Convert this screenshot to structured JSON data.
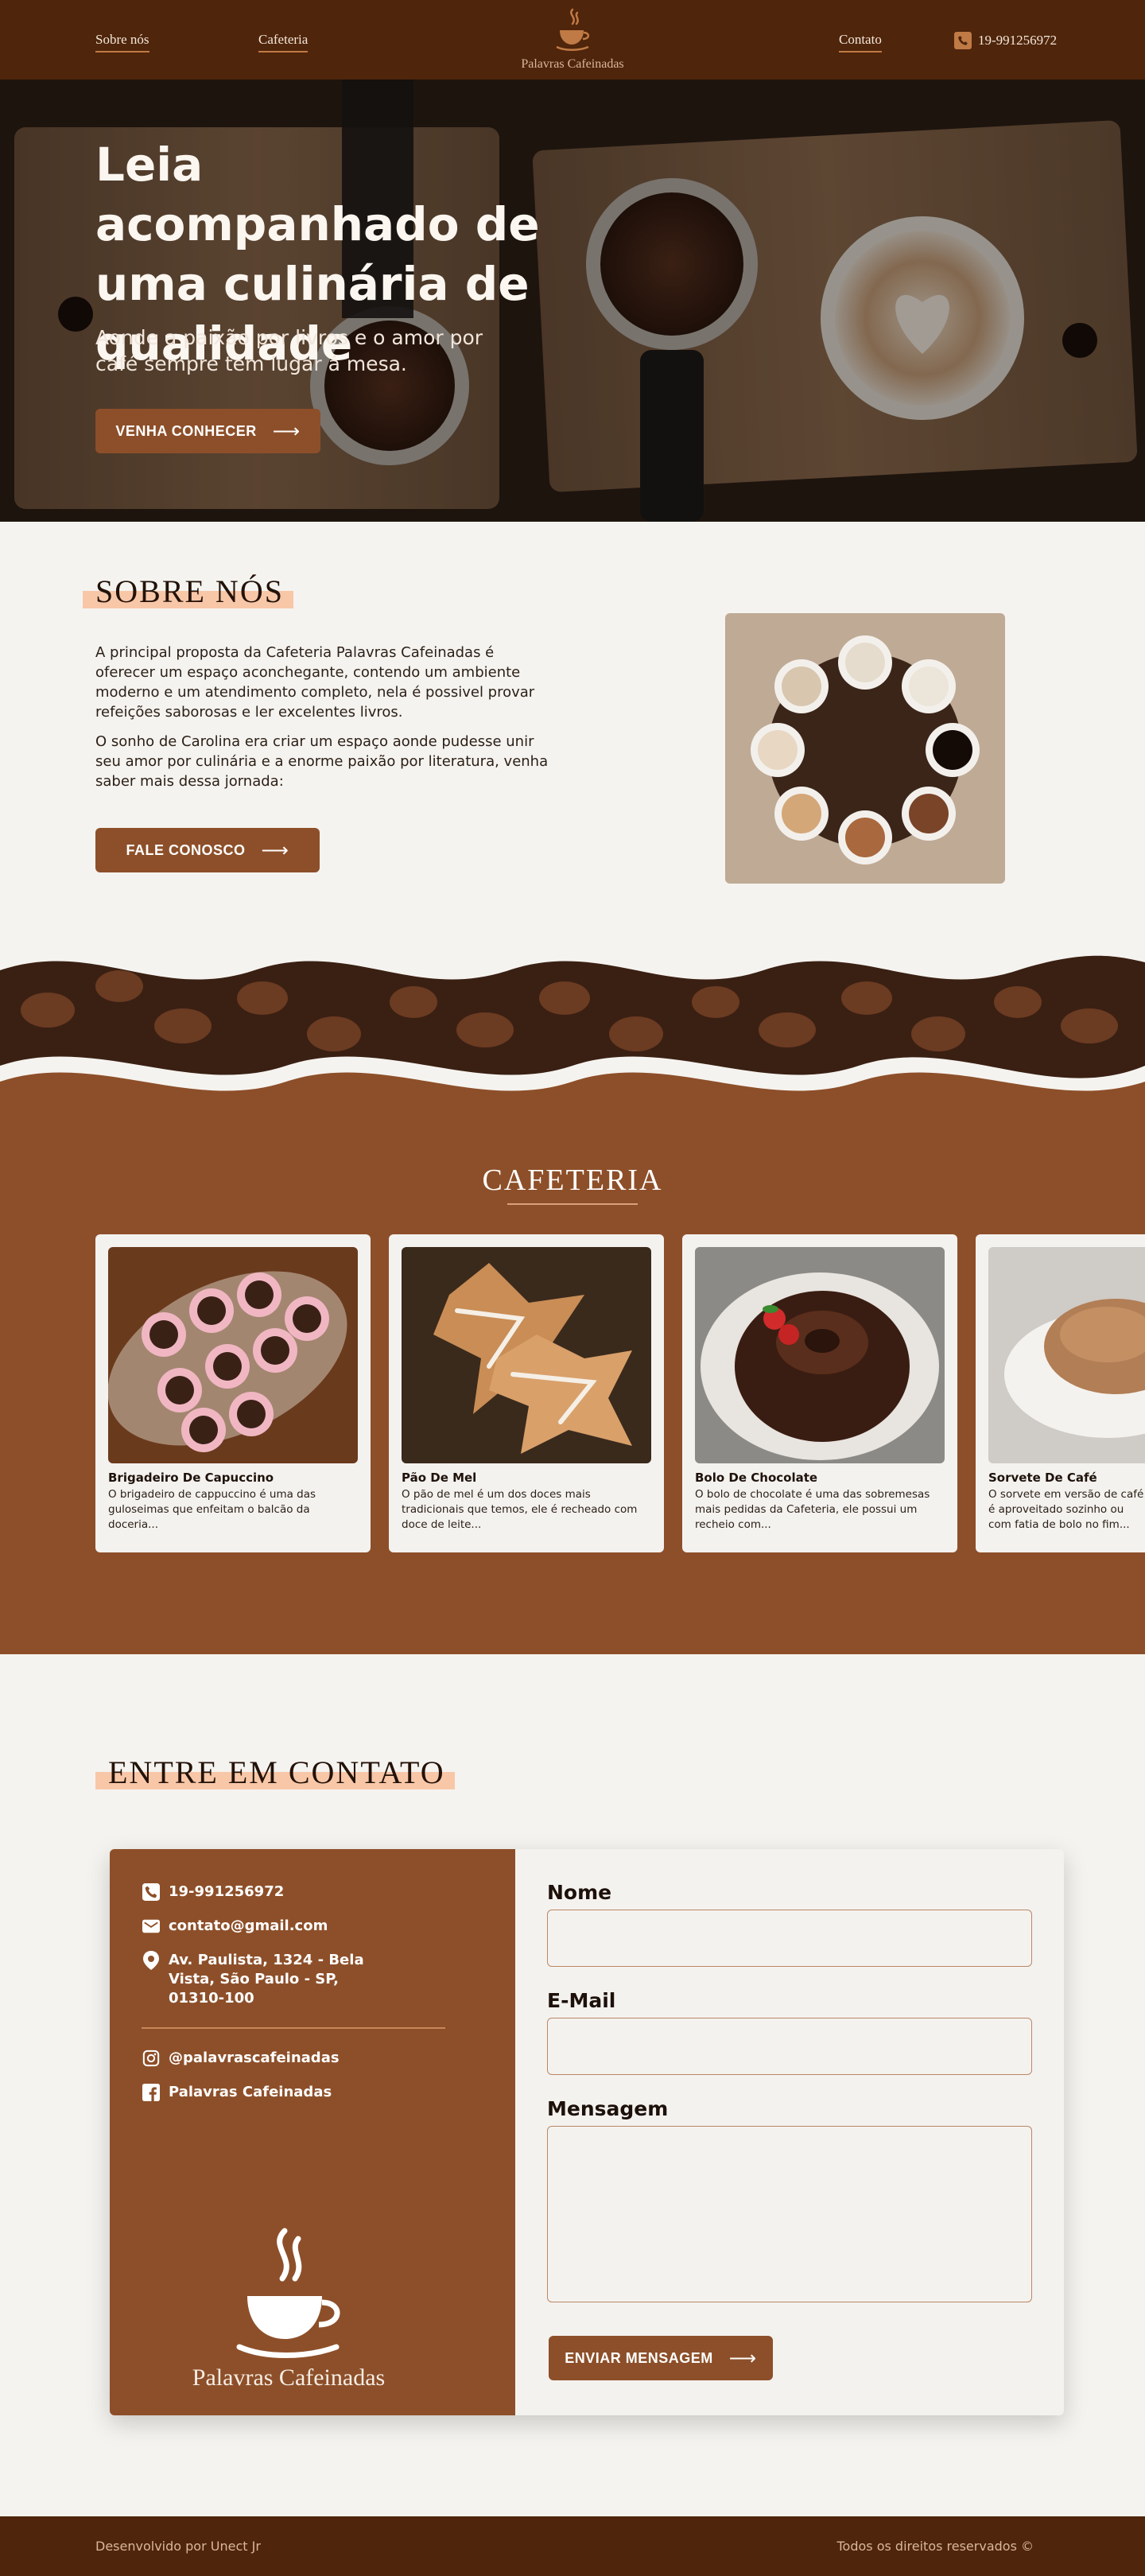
{
  "nav": {
    "about": "Sobre nós",
    "cafeteria": "Cafeteria",
    "brand": "Palavras Cafeinadas",
    "contact": "Contato",
    "phone": "19-991256972"
  },
  "hero": {
    "title": "Leia acompanhado de uma culinária de qualidade",
    "subtitle": "Aonde a paixão por livros e o amor por café sempre  tem lugar á mesa.",
    "cta": "VENHA CONHECER"
  },
  "about": {
    "title": "SOBRE NÓS",
    "p1": "A principal proposta da Cafeteria Palavras Cafeinadas é oferecer um espaço aconchegante, contendo um ambiente moderno e um atendimento completo, nela é possivel provar refeições saborosas e ler excelentes livros.",
    "p2": "O sonho de Carolina era criar um espaço aonde pudesse unir seu amor por culinária e a enorme paixão por literatura, venha saber mais dessa jornada:",
    "cta": "FALE CONOSCO"
  },
  "cafeteria": {
    "title": "CAFETERIA",
    "items": [
      {
        "name": "Brigadeiro De Capuccino",
        "desc": "O brigadeiro de cappuccino é uma das guloseimas que enfeitam o balcão da doceria..."
      },
      {
        "name": "Pão De Mel",
        "desc": "O pão de mel é um dos doces mais tradicionais que temos, ele é recheado com doce de leite..."
      },
      {
        "name": "Bolo De Chocolate",
        "desc": "O bolo de chocolate é uma das sobremesas mais pedidas da Cafeteria, ele possui um recheio com..."
      },
      {
        "name": "Sorvete De Café",
        "desc": "O sorvete em versão de café é aproveitado sozinho ou com fatia de bolo no fim..."
      }
    ]
  },
  "contact": {
    "title": "ENTRE EM CONTATO",
    "phone": "19-991256972",
    "email": "contato@gmail.com",
    "address": "Av. Paulista, 1324 - Bela Vista, São Paulo - SP, 01310-100",
    "instagram": "@palavrascafeinadas",
    "facebook": "Palavras Cafeinadas",
    "brand": "Palavras Cafeinadas",
    "form": {
      "name_label": "Nome",
      "email_label": "E-Mail",
      "message_label": "Mensagem",
      "name_value": "",
      "email_value": "",
      "message_value": "",
      "submit": "ENVIAR MENSAGEM"
    }
  },
  "footer": {
    "left": "Desenvolvido por Unect Jr",
    "right": "Todos os direitos reservados ©"
  },
  "colors": {
    "nav_bg": "#4f250b",
    "accent": "#8d4f29",
    "highlight": "#f8c7a8",
    "page_bg": "#f5f3ef"
  }
}
